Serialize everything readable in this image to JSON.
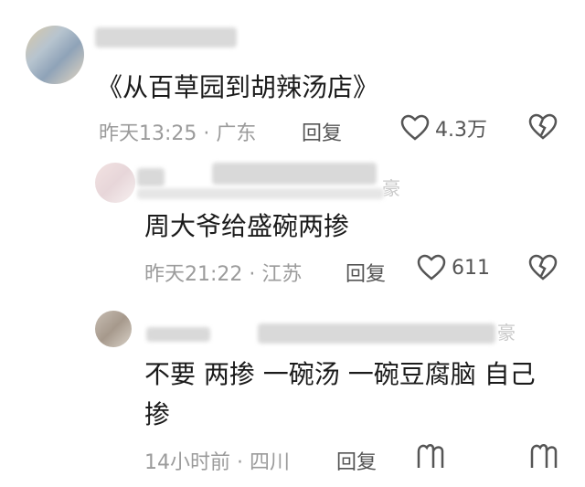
{
  "comments": [
    {
      "text": "《从百草园到胡辣汤店》",
      "time": "昨天13:25",
      "location": "广东",
      "reply_label": "回复",
      "likes": "4.3万"
    },
    {
      "text": "周大爷给盛碗两掺",
      "time": "昨天21:22",
      "location": "江苏",
      "reply_label": "回复",
      "likes": "611",
      "faded_char": "豪"
    },
    {
      "text_line1": "不要 两掺 一碗汤 一碗豆腐脑 自己",
      "text_line2": "掺",
      "time": "14小时前",
      "location": "四川",
      "reply_label": "回复",
      "faded_char": "豪"
    }
  ],
  "separator": "·",
  "icons": [
    "heart-outline-icon",
    "broken-heart-icon",
    "partial-icon"
  ]
}
